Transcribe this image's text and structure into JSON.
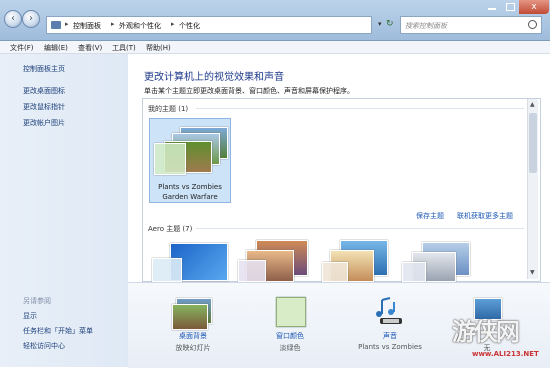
{
  "window": {
    "breadcrumb": [
      "控制面板",
      "外观和个性化",
      "个性化"
    ],
    "search_placeholder": "搜索控制面板",
    "close_glyph": "x"
  },
  "menu": [
    "文件(F)",
    "编辑(E)",
    "查看(V)",
    "工具(T)",
    "帮助(H)"
  ],
  "sidebar": {
    "home": "控制面板主页",
    "links": [
      "更改桌面图标",
      "更改鼠标指针",
      "更改帐户图片"
    ],
    "see_also_heading": "另请参阅",
    "see_also": [
      "显示",
      "任务栏和「开始」菜单",
      "轻松访问中心"
    ]
  },
  "main": {
    "title": "更改计算机上的视觉效果和声音",
    "subtitle": "单击某个主题立即更改桌面背景、窗口颜色、声音和屏幕保护程序。",
    "my_themes_label": "我的主题 (1)",
    "selected_theme_name": "Plants vs Zombies",
    "selected_theme_sub": "Garden Warfare",
    "save_theme": "保存主题",
    "get_more_themes": "联机获取更多主题",
    "aero_label": "Aero 主题 (7)"
  },
  "bottom": {
    "desktop_bg_label": "桌面背景",
    "desktop_bg_sub": "放映幻灯片",
    "window_color_label": "窗口颜色",
    "window_color_sub": "淡绿色",
    "sound_label": "声音",
    "sound_sub": "Plants vs Zombies",
    "screensaver_sub": "无"
  },
  "watermark": {
    "text": "游侠网",
    "url": "www.ALI213.NET"
  },
  "colors": {
    "title_blue": "#1d3a8a",
    "link_blue": "#1a55b5",
    "selection": "#cde3f7"
  }
}
